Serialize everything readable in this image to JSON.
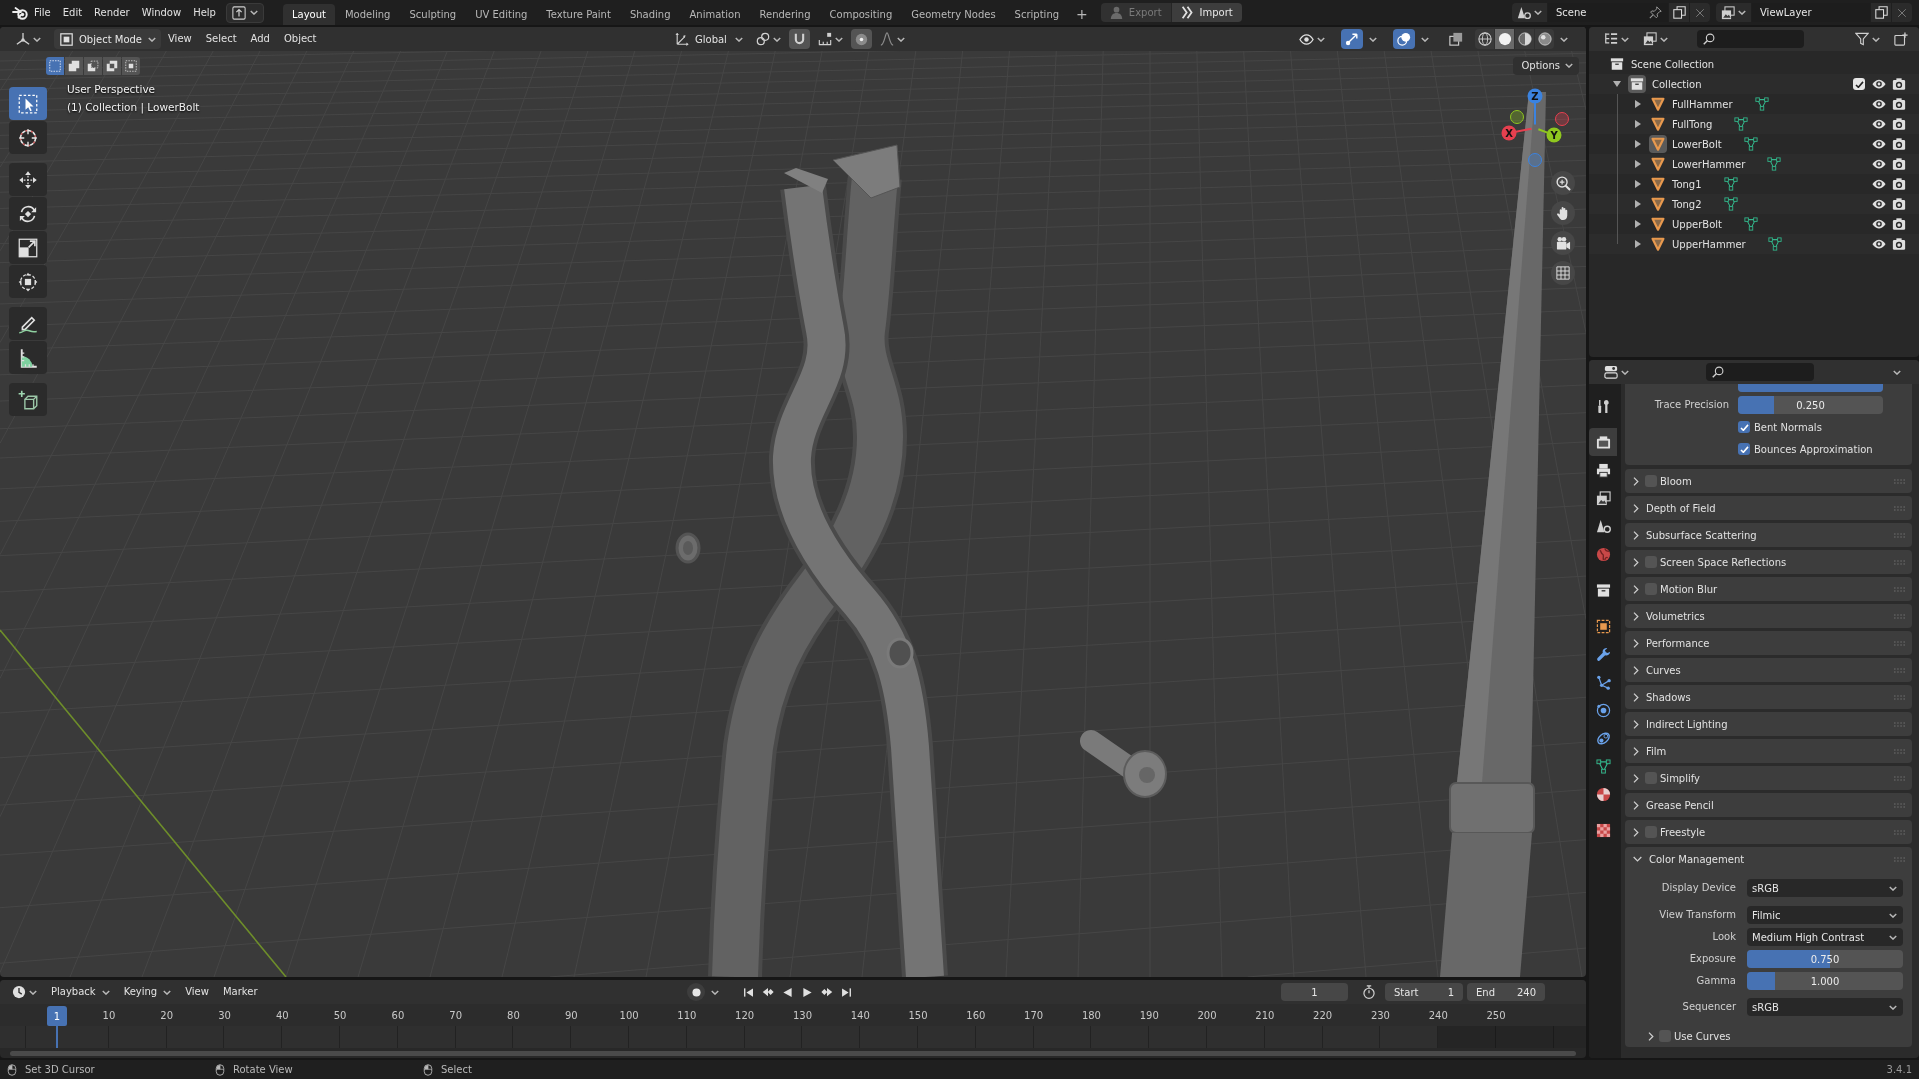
{
  "top_bar": {
    "menus": [
      "File",
      "Edit",
      "Render",
      "Window",
      "Help"
    ],
    "workspaces": [
      {
        "label": "Layout",
        "selected": true
      },
      {
        "label": "Modeling",
        "selected": false
      },
      {
        "label": "Sculpting",
        "selected": false
      },
      {
        "label": "UV Editing",
        "selected": false
      },
      {
        "label": "Texture Paint",
        "selected": false
      },
      {
        "label": "Shading",
        "selected": false
      },
      {
        "label": "Animation",
        "selected": false
      },
      {
        "label": "Rendering",
        "selected": false
      },
      {
        "label": "Compositing",
        "selected": false
      },
      {
        "label": "Geometry Nodes",
        "selected": false
      },
      {
        "label": "Scripting",
        "selected": false
      }
    ],
    "add_workspace": "+",
    "actions": [
      {
        "kind": "export",
        "label": "Export",
        "disabled": true
      },
      {
        "kind": "import",
        "label": "Import",
        "disabled": false
      }
    ],
    "scene": "Scene",
    "view_layer": "ViewLayer"
  },
  "viewport": {
    "mode": "Object Mode",
    "menus": [
      "View",
      "Select",
      "Add",
      "Object"
    ],
    "orientation": "Global",
    "header_toggles": [
      {
        "kind": "gizmos",
        "on": true
      },
      {
        "kind": "overlays",
        "on": true
      },
      {
        "kind": "xray",
        "on": false
      }
    ],
    "shading_modes": [
      {
        "kind": "wireframe",
        "selected": false
      },
      {
        "kind": "solid",
        "selected": true
      },
      {
        "kind": "material",
        "selected": false
      },
      {
        "kind": "rendered",
        "selected": false
      }
    ],
    "select_modes": [
      {
        "kind": "set",
        "selected": true
      },
      {
        "kind": "extend",
        "selected": false
      },
      {
        "kind": "subtract",
        "selected": false
      },
      {
        "kind": "difference",
        "selected": false
      },
      {
        "kind": "intersect",
        "selected": false
      }
    ],
    "options": "Options",
    "tool_groups": [
      [
        {
          "kind": "select_box",
          "selected": true
        },
        {
          "kind": "cursor",
          "selected": false
        }
      ],
      [
        {
          "kind": "move",
          "selected": false
        },
        {
          "kind": "rotate",
          "selected": false
        },
        {
          "kind": "scale",
          "selected": false
        },
        {
          "kind": "transform",
          "selected": false
        }
      ],
      [
        {
          "kind": "annotate",
          "selected": false
        },
        {
          "kind": "measure",
          "selected": false
        }
      ],
      [
        {
          "kind": "add_cube",
          "selected": false
        }
      ]
    ],
    "info": [
      "User Perspective",
      "(1) Collection | LowerBolt"
    ],
    "gizmo_axes": [
      {
        "label": "Z",
        "color": "#3b83e0"
      },
      {
        "label": "X",
        "color": "#e6404f"
      },
      {
        "label": "Y",
        "color": "#8fc71f"
      }
    ]
  },
  "timeline": {
    "menus": [
      {
        "label": "Playback",
        "kind": "dropdown"
      },
      {
        "label": "Keying",
        "kind": "dropdown"
      },
      {
        "label": "View",
        "kind": "menu"
      },
      {
        "label": "Marker",
        "kind": "menu"
      }
    ],
    "auto_keying": false,
    "current_frame": "1",
    "range": [
      {
        "label": "Start",
        "value": "1"
      },
      {
        "label": "End",
        "value": "240"
      }
    ],
    "playhead": "1",
    "ruler": [
      "10",
      "20",
      "30",
      "40",
      "50",
      "60",
      "70",
      "80",
      "90",
      "100",
      "110",
      "120",
      "130",
      "140",
      "150",
      "160",
      "170",
      "180",
      "190",
      "200",
      "210",
      "220",
      "230",
      "240",
      "250"
    ]
  },
  "outliner": {
    "root": "Scene Collection",
    "collections": [
      {
        "name": "Collection",
        "expanded": true,
        "checked": true,
        "selected": true,
        "children": [
          {
            "name": "FullHammer",
            "expanded": false,
            "selected": false
          },
          {
            "name": "FullTong",
            "expanded": false,
            "selected": false
          },
          {
            "name": "LowerBolt",
            "expanded": false,
            "selected": true
          },
          {
            "name": "LowerHammer",
            "expanded": false,
            "selected": false
          },
          {
            "name": "Tong1",
            "expanded": false,
            "selected": false
          },
          {
            "name": "Tong2",
            "expanded": false,
            "selected": false
          },
          {
            "name": "UpperBolt",
            "expanded": false,
            "selected": false
          },
          {
            "name": "UpperHammer",
            "expanded": false,
            "selected": false
          }
        ]
      }
    ]
  },
  "properties": {
    "tab_groups": [
      [
        {
          "kind": "tool",
          "selected": false
        }
      ],
      [
        {
          "kind": "render",
          "selected": true
        },
        {
          "kind": "output",
          "selected": false
        },
        {
          "kind": "view_layer",
          "selected": false
        },
        {
          "kind": "scene",
          "selected": false
        },
        {
          "kind": "world",
          "selected": false
        }
      ],
      [
        {
          "kind": "collection",
          "selected": false
        }
      ],
      [
        {
          "kind": "object",
          "selected": false
        },
        {
          "kind": "modifiers",
          "selected": false
        },
        {
          "kind": "particles",
          "selected": false
        },
        {
          "kind": "physics",
          "selected": false
        },
        {
          "kind": "constraints",
          "selected": false
        },
        {
          "kind": "data",
          "selected": false
        },
        {
          "kind": "material",
          "selected": false
        }
      ],
      [
        {
          "kind": "texture",
          "selected": false
        }
      ]
    ],
    "clipped_slider": {
      "level": 1
    },
    "settings": [
      {
        "kind": "slider",
        "label": "Trace Precision",
        "value": "0.250",
        "level": 0.25
      },
      {
        "kind": "checkbox",
        "label": "Bent Normals",
        "checked": true
      },
      {
        "kind": "checkbox",
        "label": "Bounces Approximation",
        "checked": true
      }
    ],
    "panels": [
      {
        "title": "Bloom",
        "kind": "toggle",
        "checked": false,
        "expanded": false
      },
      {
        "title": "Depth of Field",
        "kind": "plain",
        "expanded": false
      },
      {
        "title": "Subsurface Scattering",
        "kind": "plain",
        "expanded": false
      },
      {
        "title": "Screen Space Reflections",
        "kind": "toggle",
        "checked": false,
        "expanded": false
      },
      {
        "title": "Motion Blur",
        "kind": "toggle",
        "checked": false,
        "expanded": false
      },
      {
        "title": "Volumetrics",
        "kind": "plain",
        "expanded": false
      },
      {
        "title": "Performance",
        "kind": "plain",
        "expanded": false
      },
      {
        "title": "Curves",
        "kind": "plain",
        "expanded": false
      },
      {
        "title": "Shadows",
        "kind": "plain",
        "expanded": false
      },
      {
        "title": "Indirect Lighting",
        "kind": "plain",
        "expanded": false
      },
      {
        "title": "Film",
        "kind": "plain",
        "expanded": false
      },
      {
        "title": "Simplify",
        "kind": "toggle",
        "checked": false,
        "expanded": false
      },
      {
        "title": "Grease Pencil",
        "kind": "plain",
        "expanded": false
      },
      {
        "title": "Freestyle",
        "kind": "toggle",
        "checked": false,
        "expanded": false
      },
      {
        "title": "Color Management",
        "kind": "plain",
        "expanded": true,
        "groups": [
          [
            {
              "kind": "dropdown",
              "label": "Display Device",
              "value": "sRGB"
            }
          ],
          [
            {
              "kind": "dropdown",
              "label": "View Transform",
              "value": "Filmic"
            },
            {
              "kind": "dropdown",
              "label": "Look",
              "value": "Medium High Contrast"
            },
            {
              "kind": "slider",
              "label": "Exposure",
              "value": "0.750",
              "level": 0.53
            },
            {
              "kind": "slider",
              "label": "Gamma",
              "value": "1.000",
              "level": 0.18
            }
          ],
          [
            {
              "kind": "dropdown",
              "label": "Sequencer",
              "value": "sRGB"
            }
          ]
        ],
        "subpanels": [
          {
            "title": "Use Curves",
            "kind": "toggle",
            "checked": false,
            "expanded": false
          }
        ]
      }
    ]
  },
  "status_bar": {
    "hints": [
      "Set 3D Cursor",
      "Rotate View",
      "Select"
    ],
    "version": "3.4.1"
  }
}
